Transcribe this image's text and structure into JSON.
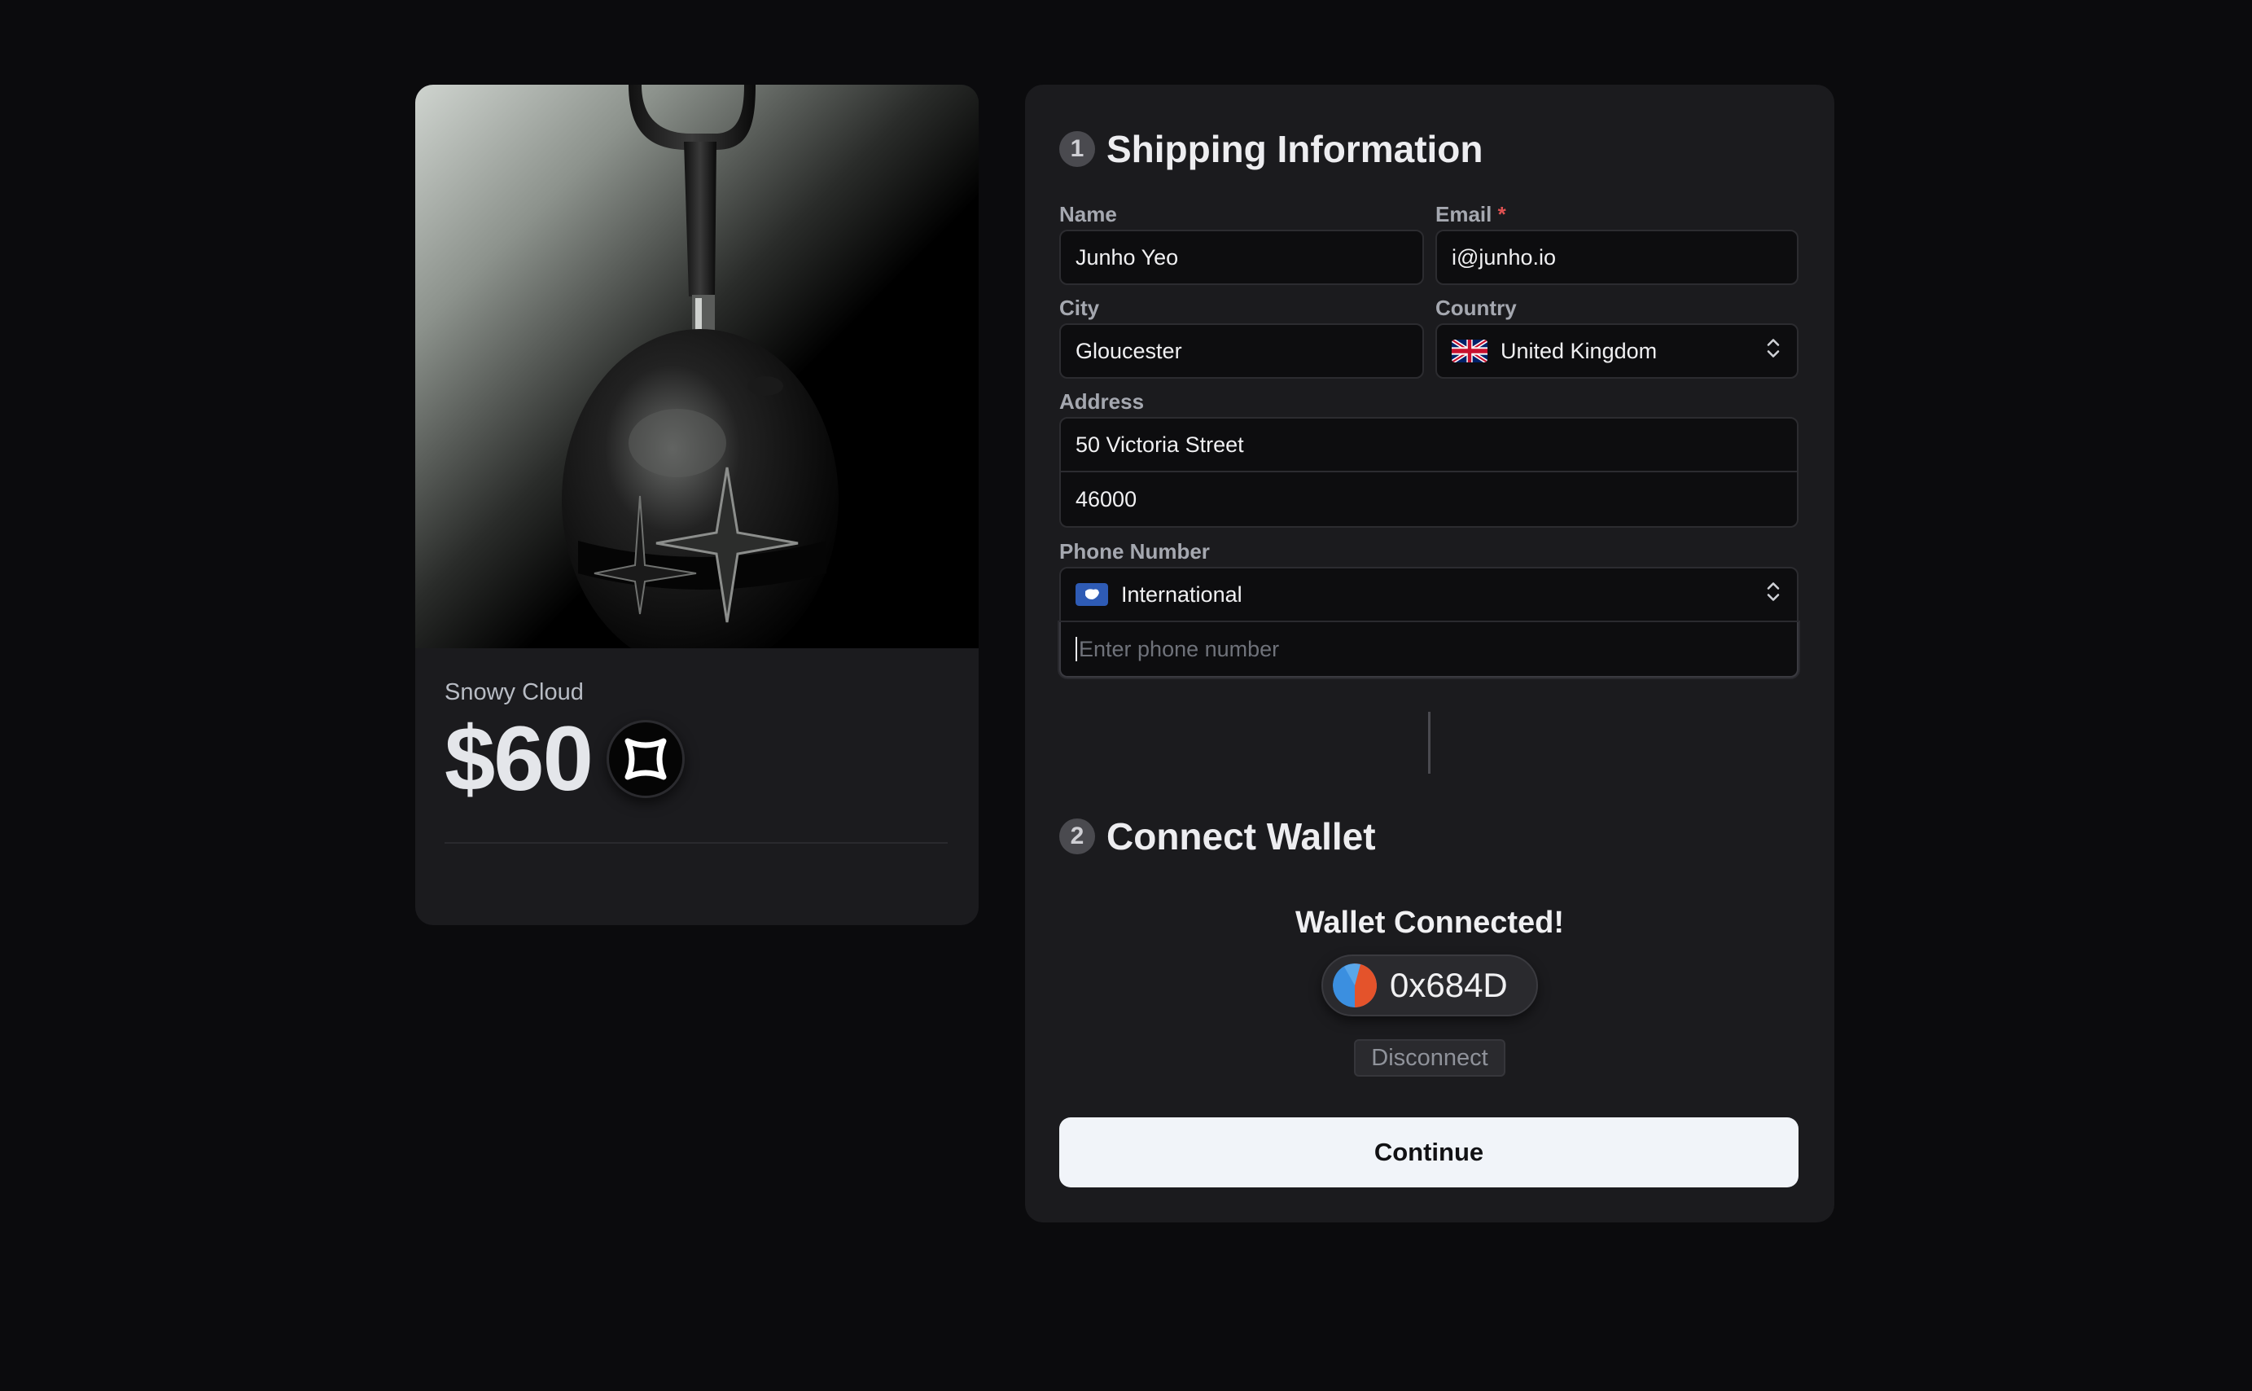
{
  "product": {
    "name": "Snowy Cloud",
    "price": "$60",
    "token_icon": "token-coin-icon"
  },
  "shipping": {
    "step": "1",
    "title": "Shipping Information",
    "name_label": "Name",
    "name_value": "Junho Yeo",
    "email_label": "Email",
    "email_required": "*",
    "email_value": "i@junho.io",
    "city_label": "City",
    "city_value": "Gloucester",
    "country_label": "Country",
    "country_value": "United Kingdom",
    "country_flag": "uk-flag-icon",
    "address_label": "Address",
    "address_line1": "50 Victoria Street",
    "address_line2": "46000",
    "phone_label": "Phone Number",
    "phone_country": "International",
    "phone_flag": "globe-flag-icon",
    "phone_placeholder": "Enter phone number"
  },
  "wallet": {
    "step": "2",
    "title": "Connect Wallet",
    "status": "Wallet Connected!",
    "address": "0x684D",
    "disconnect_label": "Disconnect"
  },
  "actions": {
    "continue_label": "Continue"
  },
  "colors": {
    "background": "#0b0b0d",
    "panel": "#1b1b1e",
    "input_bg": "#0d0d0f",
    "primary_button": "#f1f4f9",
    "required": "#e05252"
  }
}
